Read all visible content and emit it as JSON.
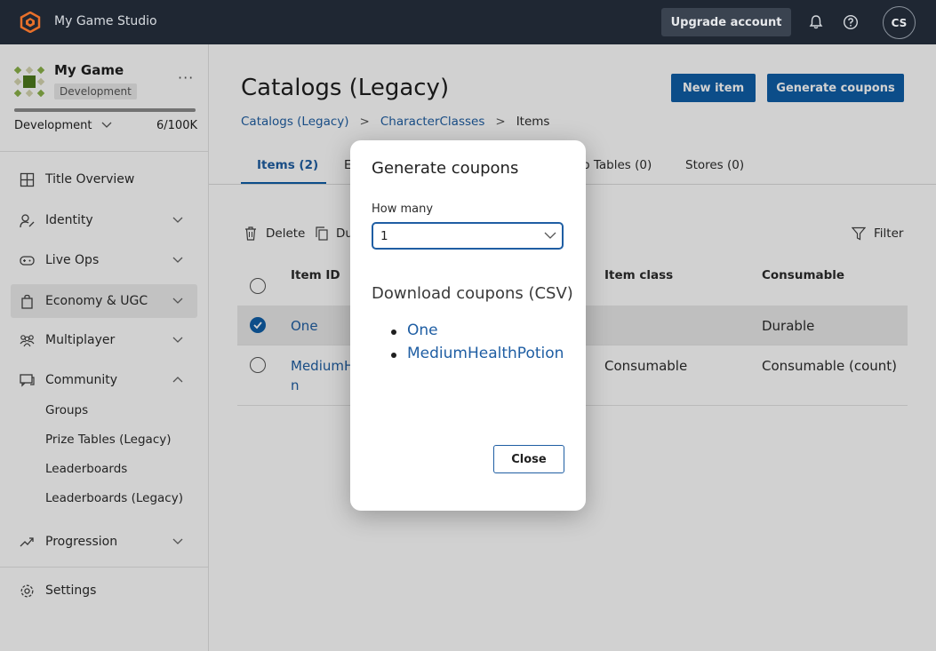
{
  "app": {
    "studio_name": "My Game Studio",
    "upgrade_label": "Upgrade account",
    "avatar_initials": "CS"
  },
  "sidebar": {
    "game_name": "My Game",
    "env_badge": "Development",
    "env_select": "Development",
    "env_count": "6/100K",
    "usage_fraction": 1.0,
    "items": [
      {
        "label": "Title Overview",
        "icon": "grid-icon"
      },
      {
        "label": "Identity",
        "icon": "identity-icon"
      },
      {
        "label": "Live Ops",
        "icon": "gamepad-icon"
      },
      {
        "label": "Economy & UGC",
        "icon": "bag-icon"
      },
      {
        "label": "Multiplayer",
        "icon": "people-icon"
      },
      {
        "label": "Community",
        "icon": "chat-icon"
      },
      {
        "label": "Progression",
        "icon": "trend-icon"
      },
      {
        "label": "Settings",
        "icon": "gear-icon"
      }
    ],
    "community_sub": [
      "Groups",
      "Prize Tables (Legacy)",
      "Leaderboards",
      "Leaderboards (Legacy)"
    ]
  },
  "main": {
    "title": "Catalogs (Legacy)",
    "new_item_label": "New item",
    "generate_coupons_label": "Generate coupons",
    "breadcrumb": [
      "Catalogs (Legacy)",
      "CharacterClasses",
      "Items"
    ],
    "tabs": [
      "Items (2)",
      "E",
      "p Tables (0)",
      "Stores (0)"
    ],
    "toolbar": {
      "delete": "Delete",
      "duplicate": "Du",
      "filter": "Filter"
    },
    "table": {
      "headers": [
        "Item ID",
        "Item class",
        "Consumable"
      ],
      "rows": [
        {
          "id": "One",
          "class": "",
          "consumable": "Durable"
        },
        {
          "id_line1": "MediumH",
          "id_line2": "n",
          "class": "Consumable",
          "consumable": "Consumable (count)"
        }
      ]
    }
  },
  "modal": {
    "title": "Generate coupons",
    "how_many_label": "How many",
    "how_many_value": "1",
    "download_heading": "Download coupons (CSV)",
    "links": [
      "One",
      "MediumHealthPotion"
    ],
    "close_label": "Close"
  },
  "colors": {
    "topbar": "#1f2733",
    "primary": "#0f5ea8",
    "link": "#1f5ea3",
    "logo": "#e8702a"
  }
}
